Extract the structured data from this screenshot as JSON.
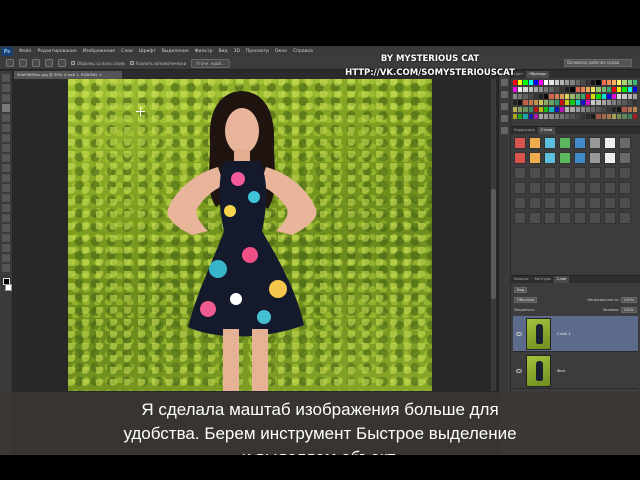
{
  "app": {
    "logo": "Ps",
    "menu": [
      "Файл",
      "Редактирование",
      "Изображение",
      "Слои",
      "Шрифт",
      "Выделение",
      "Фильтр",
      "Вид",
      "3D",
      "Просмотр",
      "Окно",
      "Справка"
    ],
    "options": {
      "checkbox1": "Образец со всех слоев",
      "checkbox2": "Усилить автоматически",
      "refine_button": "Уточн. край...",
      "workspace": "Основная рабочая среда"
    },
    "document_tab": "50a99890ac.jpg @ 39% (Слой 1, RGB/8#) ×"
  },
  "panels": {
    "swatch_tabs": [
      "Цвет",
      "Образцы"
    ],
    "style_tabs": [
      "Коррекция",
      "Стили"
    ],
    "layer_tabs": [
      "Каналы",
      "Контуры",
      "Слои"
    ],
    "layers_kind": "Вид",
    "blend_mode": "Обычные",
    "opacity_label": "Непрозрачность:",
    "opacity_value": "100%",
    "lock_label": "Закрепить:",
    "fill_label": "Заливка:",
    "fill_value": "100%",
    "layers": [
      {
        "name": "Слой 1",
        "selected": true
      },
      {
        "name": "Фон",
        "selected": false
      }
    ],
    "swatch_colors": [
      "#ff0000",
      "#ffff00",
      "#00ff00",
      "#00ffff",
      "#0000ff",
      "#ff00ff",
      "#ffffff",
      "#e6e6e6",
      "#cccccc",
      "#b3b3b3",
      "#999999",
      "#808080",
      "#666666",
      "#4d4d4d",
      "#333333",
      "#1a1a1a",
      "#000000",
      "#f26c4f",
      "#f68e55",
      "#fbaf5c",
      "#fff467",
      "#acd372",
      "#7cc576",
      "#3bb878"
    ]
  },
  "watermark": {
    "line1": "BY MYSTERIOUS CAT",
    "line2": "HTTP://VK.COM/SOMYSTERIOUSCAT"
  },
  "subtitle": {
    "line1": "Я сделала маштаб изображения больше для",
    "line2": "удобства. Берем инструмент Быстрое выделение",
    "line3": "и выделяем объект."
  }
}
